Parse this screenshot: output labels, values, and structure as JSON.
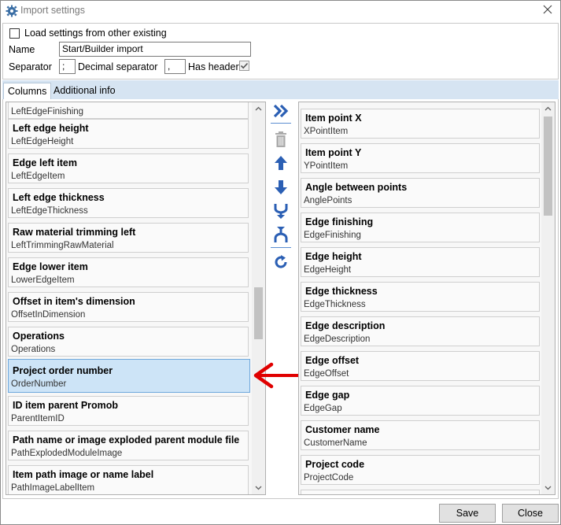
{
  "window": {
    "title": "Import settings"
  },
  "top": {
    "load_label": "Load settings from other existing",
    "name_label": "Name",
    "name_value": "Start/Builder import",
    "separator_label": "Separator",
    "separator_value": ";",
    "decimal_label": "Decimal separator",
    "decimal_value": ",",
    "header_label": "Has header",
    "has_header": true
  },
  "tabs": [
    {
      "label": "Columns",
      "active": true
    },
    {
      "label": "Additional info",
      "active": false
    }
  ],
  "left_list": {
    "partial_top": "LeftEdgeFinishing",
    "items": [
      {
        "title": "Left edge height",
        "key": "LeftEdgeHeight"
      },
      {
        "title": "Edge left item",
        "key": "LeftEdgeItem"
      },
      {
        "title": "Left edge thickness",
        "key": "LeftEdgeThickness"
      },
      {
        "title": "Raw material trimming left",
        "key": "LeftTrimmingRawMaterial"
      },
      {
        "title": "Edge lower item",
        "key": "LowerEdgeItem"
      },
      {
        "title": "Offset in item's dimension",
        "key": "OffsetInDimension"
      },
      {
        "title": "Operations",
        "key": "Operations"
      },
      {
        "title": "Project order number",
        "key": "OrderNumber",
        "selected": true
      },
      {
        "title": "ID item parent Promob",
        "key": "ParentItemID"
      },
      {
        "title": "Path name or image exploded parent module file",
        "key": "PathExplodedModuleImage"
      },
      {
        "title": "Item path image or name label",
        "key": "PathImageLabelItem"
      }
    ]
  },
  "right_list": {
    "items": [
      {
        "title": "Item point X",
        "key": "XPointItem"
      },
      {
        "title": "Item point Y",
        "key": "YPointItem"
      },
      {
        "title": "Angle between points",
        "key": "AnglePoints"
      },
      {
        "title": "Edge finishing",
        "key": "EdgeFinishing"
      },
      {
        "title": "Edge height",
        "key": "EdgeHeight"
      },
      {
        "title": "Edge thickness",
        "key": "EdgeThickness"
      },
      {
        "title": "Edge description",
        "key": "EdgeDescription"
      },
      {
        "title": "Edge offset",
        "key": "EdgeOffset"
      },
      {
        "title": "Edge gap",
        "key": "EdgeGap"
      },
      {
        "title": "Customer name",
        "key": "CustomerName"
      },
      {
        "title": "Project code",
        "key": "ProjectCode"
      }
    ]
  },
  "toolbar": [
    {
      "icon": "move-all-right-icon"
    },
    {
      "icon": "delete-icon"
    },
    {
      "icon": "move-up-icon"
    },
    {
      "icon": "move-down-icon"
    },
    {
      "icon": "merge-icon"
    },
    {
      "icon": "split-icon"
    },
    {
      "icon": "refresh-icon"
    }
  ],
  "buttons": {
    "save": "Save",
    "close": "Close"
  },
  "colors": {
    "accent": "#2b5fb4",
    "selection": "#cde4f7",
    "arrow": "#e00000"
  }
}
